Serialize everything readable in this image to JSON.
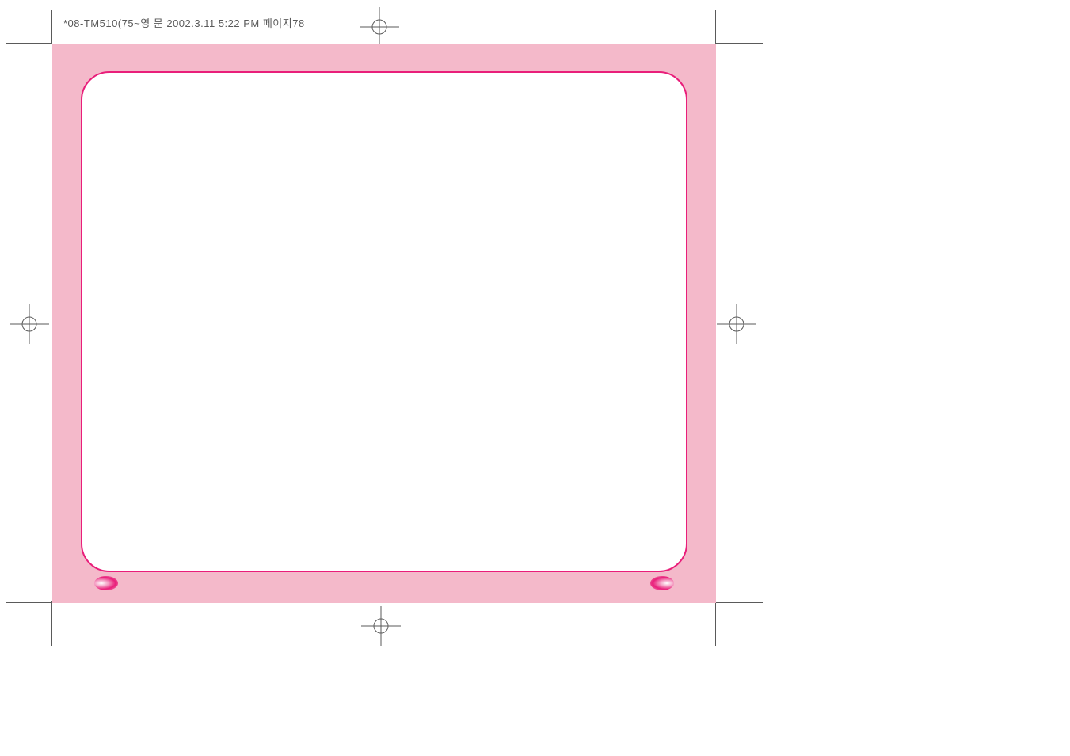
{
  "header": {
    "file_info": "*08-TM510(75~영 문  2002.3.11 5:22 PM  페이지78"
  },
  "colors": {
    "pink_bg": "#f4b9ca",
    "magenta_border": "#e91e7a",
    "crop_mark": "#5a5a5a"
  }
}
